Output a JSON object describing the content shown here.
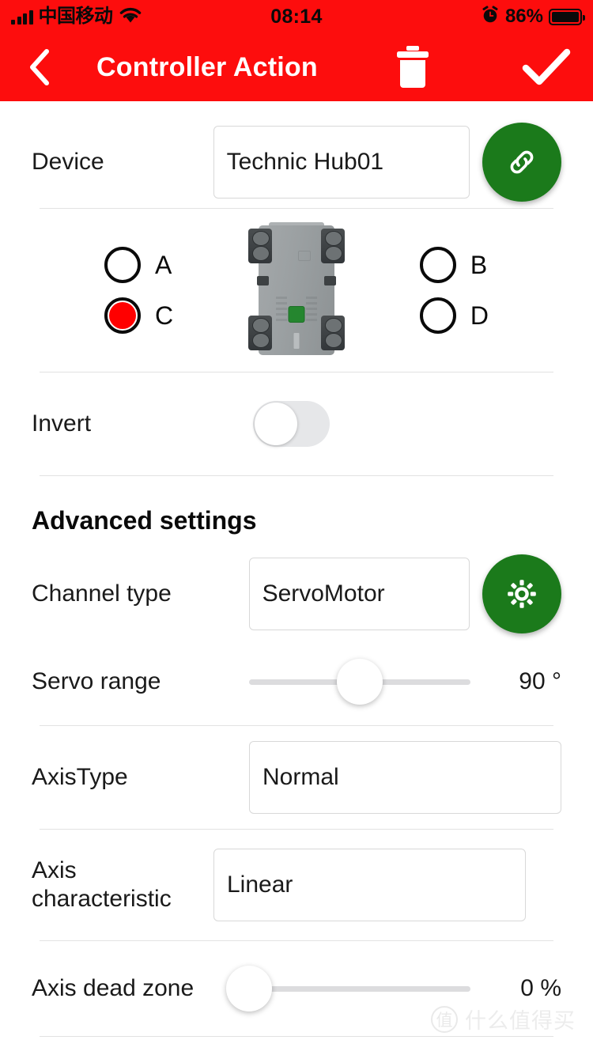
{
  "status_bar": {
    "carrier": "中国移动",
    "time": "08:14",
    "battery_percent": "86%",
    "signal_icon": "signal-bars-icon",
    "wifi_icon": "wifi-icon",
    "alarm_icon": "alarm-clock-icon",
    "battery_icon": "battery-icon"
  },
  "nav_bar": {
    "title": "Controller Action",
    "back_icon": "chevron-left-icon",
    "delete_icon": "trash-icon",
    "confirm_icon": "checkmark-icon",
    "background_color": "#FD0D0D",
    "text_color": "#FFFFFF"
  },
  "device": {
    "label": "Device",
    "value": "Technic Hub01",
    "connect_icon": "link-icon",
    "button_color": "#1B7A1B"
  },
  "ports": {
    "selected": "C",
    "left": [
      {
        "id": "A",
        "label": "A",
        "selected": false
      },
      {
        "id": "C",
        "label": "C",
        "selected": true
      }
    ],
    "right": [
      {
        "id": "B",
        "label": "B",
        "selected": false
      },
      {
        "id": "D",
        "label": "D",
        "selected": false
      }
    ],
    "selected_color": "#FF0000",
    "hub_image": "technic-hub-image"
  },
  "invert": {
    "label": "Invert",
    "enabled": false
  },
  "advanced": {
    "heading": "Advanced settings",
    "channel_type": {
      "label": "Channel type",
      "value": "ServoMotor",
      "settings_icon": "gear-icon",
      "button_color": "#1B7A1B"
    },
    "servo_range": {
      "label": "Servo range",
      "value": "90 °",
      "percent": 50
    },
    "axis_type": {
      "label": "AxisType",
      "value": "Normal"
    },
    "axis_characteristic": {
      "label_line1": "Axis",
      "label_line2": "characteristic",
      "value": "Linear"
    },
    "axis_dead_zone": {
      "label": "Axis dead zone",
      "value": "0 %",
      "percent": 0
    }
  },
  "watermark": {
    "mark": "值",
    "text": "什么值得买"
  }
}
